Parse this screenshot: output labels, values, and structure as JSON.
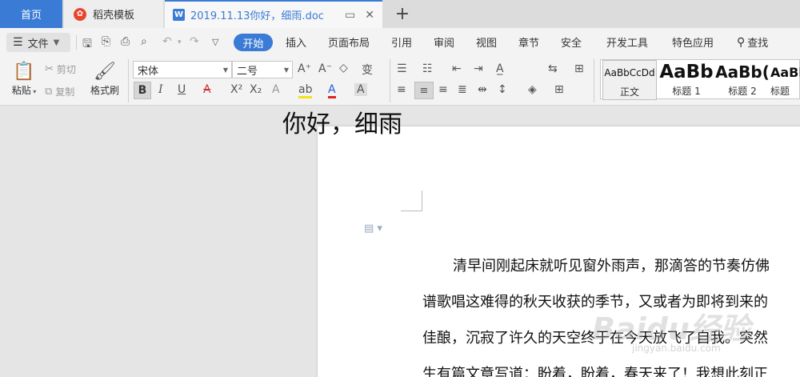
{
  "tabs": {
    "home": "首页",
    "template": "稻壳模板",
    "doc": "2019.11.13你好，细雨.doc",
    "add": "+"
  },
  "menu": {
    "file": "文件",
    "items": [
      "开始",
      "插入",
      "页面布局",
      "引用",
      "审阅",
      "视图",
      "章节",
      "安全",
      "开发工具",
      "特色应用"
    ],
    "search": "查找"
  },
  "ribbon": {
    "paste": "粘贴",
    "cut": "剪切",
    "copy": "复制",
    "format_painter": "格式刷",
    "font_name": "宋体",
    "font_size": "二号"
  },
  "styles": [
    {
      "preview": "AaBbCcDd",
      "label": "正文"
    },
    {
      "preview": "AaBb",
      "label": "标题 1"
    },
    {
      "preview": "AaBb(",
      "label": "标题 2"
    },
    {
      "preview": "AaBb",
      "label": "标题"
    }
  ],
  "document": {
    "title": "你好，细雨",
    "lines": [
      "清早间刚起床就听见窗外雨声，那滴答的节奏仿佛",
      "谱歌唱这难得的秋天收获的季节，又或者为即将到来的",
      "佳酿，沉寂了许久的天空终于在今天放飞了自我。突然",
      "生有篇文章写道：盼着，盼着，春天来了！我想此刻正"
    ]
  },
  "watermark": {
    "main": "Baidu经验",
    "sub": "jingyan.baidu.com"
  },
  "colors": {
    "accent": "#3a7bd5",
    "tabbar": "#dcdcdc",
    "ribbon": "#f3f3f3",
    "workspace": "#e5e5e5"
  }
}
